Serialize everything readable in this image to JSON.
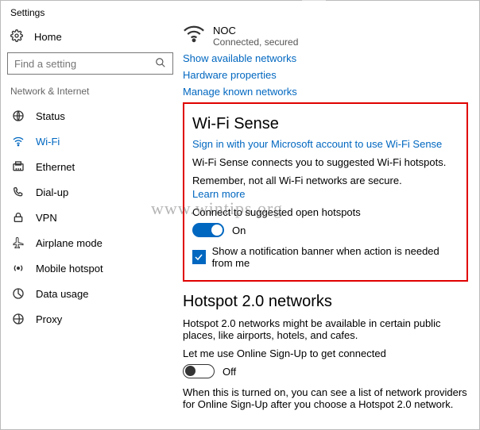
{
  "window": {
    "title": "Settings"
  },
  "sidebar": {
    "home_label": "Home",
    "search_placeholder": "Find a setting",
    "category": "Network & Internet",
    "items": [
      {
        "label": "Status"
      },
      {
        "label": "Wi-Fi"
      },
      {
        "label": "Ethernet"
      },
      {
        "label": "Dial-up"
      },
      {
        "label": "VPN"
      },
      {
        "label": "Airplane mode"
      },
      {
        "label": "Mobile hotspot"
      },
      {
        "label": "Data usage"
      },
      {
        "label": "Proxy"
      }
    ]
  },
  "connection": {
    "name": "NOC",
    "status": "Connected, secured"
  },
  "links": {
    "show_available": "Show available networks",
    "hardware_props": "Hardware properties",
    "manage_known": "Manage known networks"
  },
  "wifi_sense": {
    "title": "Wi-Fi Sense",
    "signin_link": "Sign in with your Microsoft account to use Wi-Fi Sense",
    "desc": "Wi-Fi Sense connects you to suggested Wi-Fi hotspots.",
    "remember": "Remember, not all Wi-Fi networks are secure.",
    "learn_more": "Learn more",
    "connect_label": "Connect to suggested open hotspots",
    "connect_state": "On",
    "notify_label": "Show a notification banner when action is needed from me"
  },
  "hotspot2": {
    "title": "Hotspot 2.0 networks",
    "desc": "Hotspot 2.0 networks might be available in certain public places, like airports, hotels, and cafes.",
    "signup_label": "Let me use Online Sign-Up to get connected",
    "signup_state": "Off",
    "note": "When this is turned on, you can see a list of network providers for Online Sign-Up after you choose a Hotspot 2.0 network."
  },
  "watermark": "www.wintips.org"
}
